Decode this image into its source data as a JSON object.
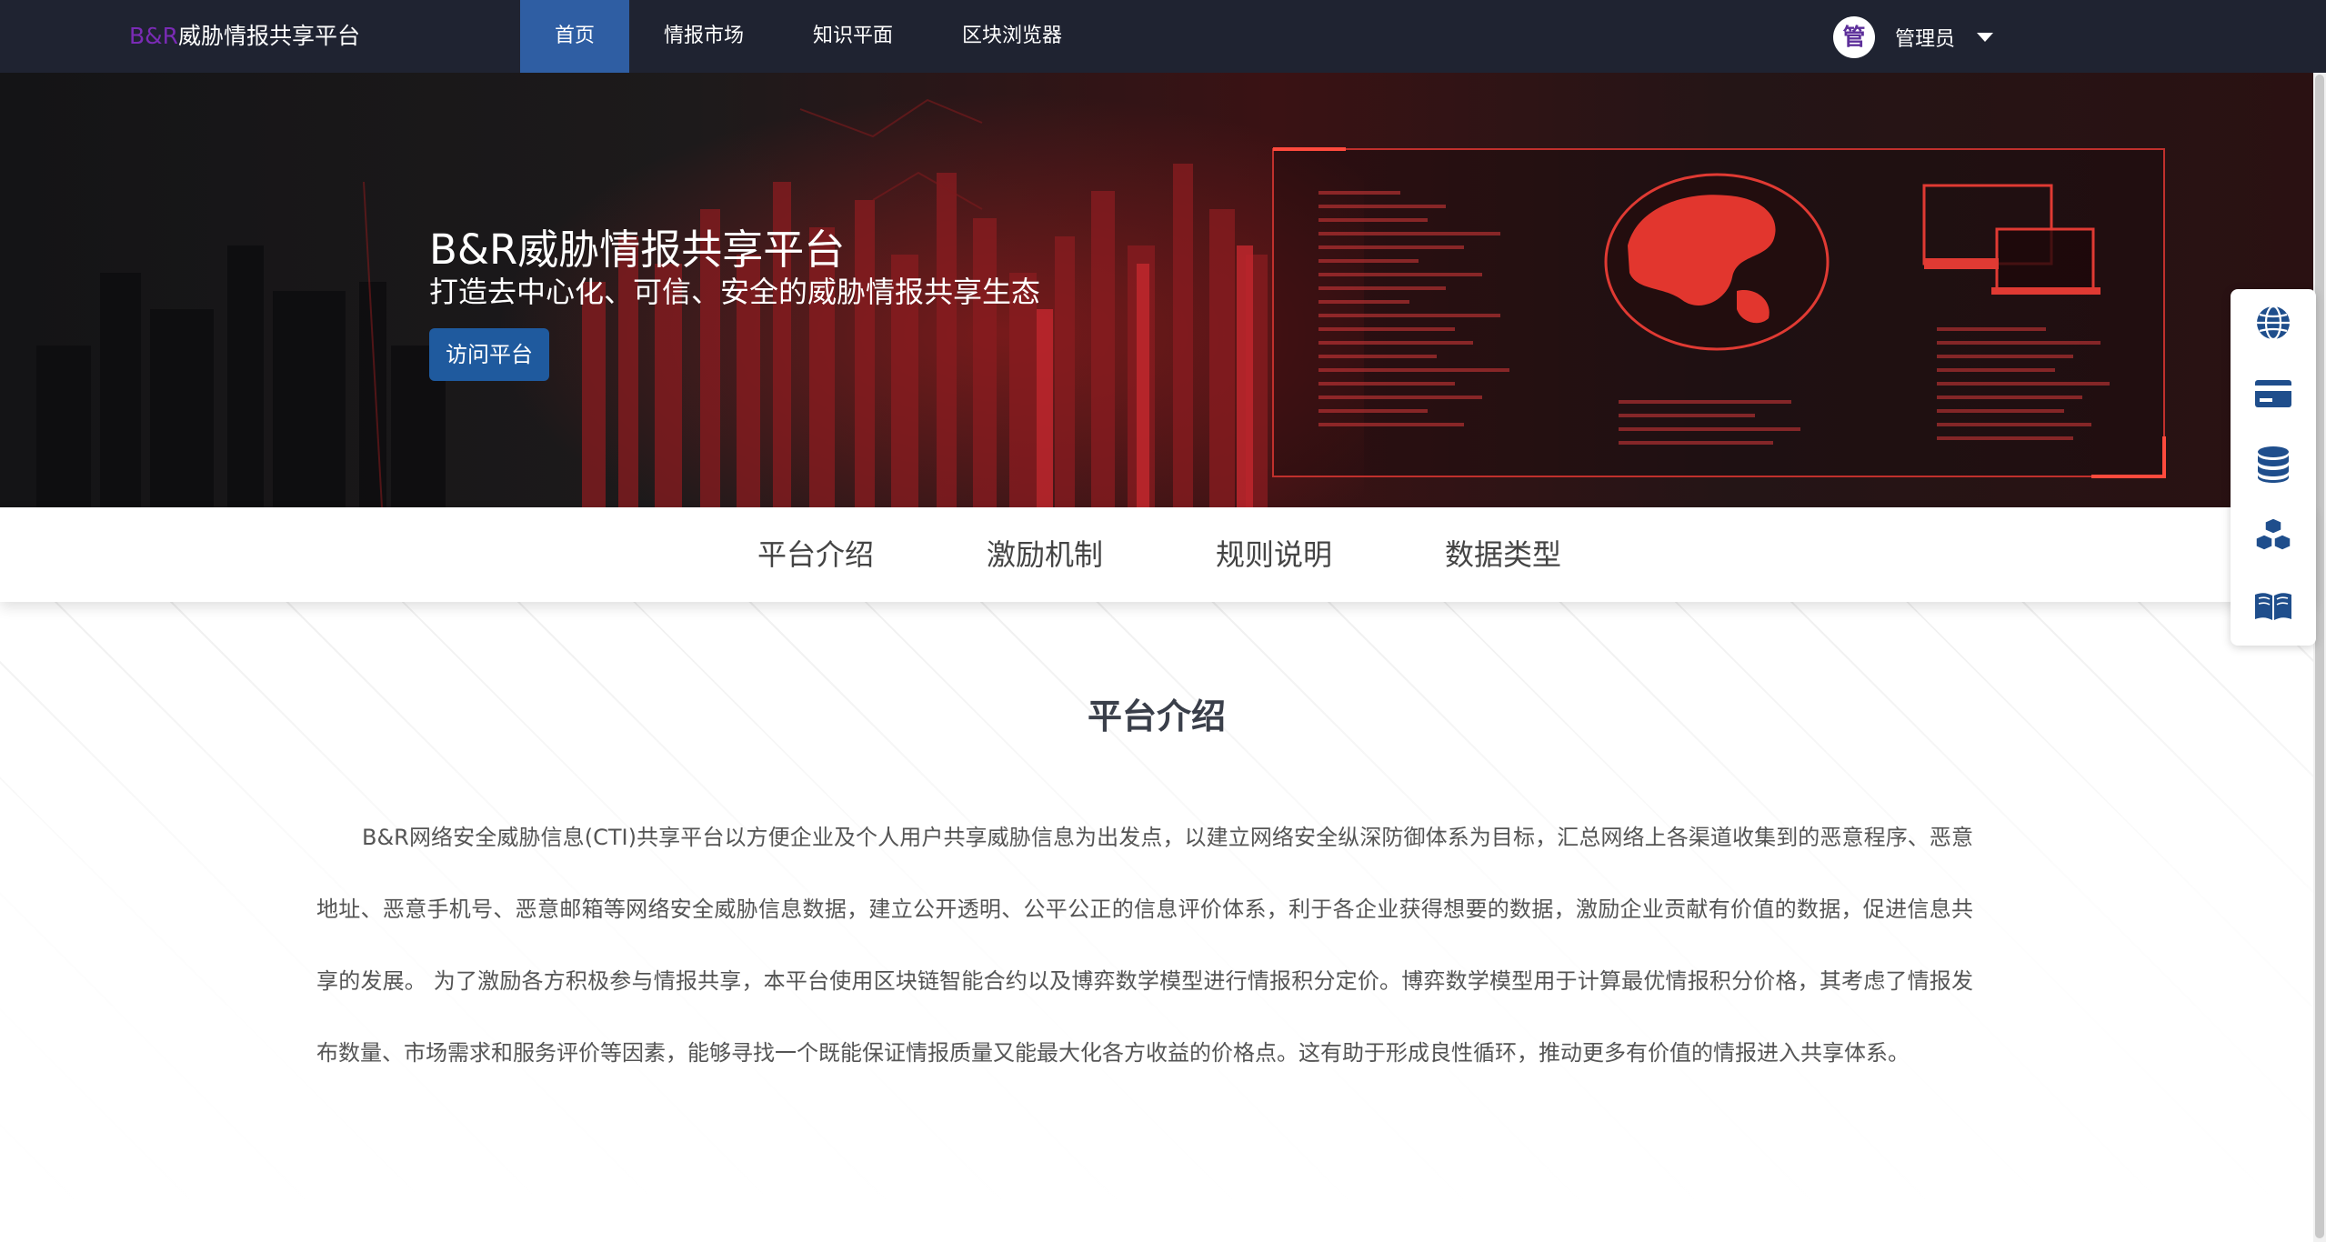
{
  "brand": {
    "prefix": "B&R",
    "suffix": "威胁情报共享平台"
  },
  "nav": {
    "items": [
      {
        "label": "首页",
        "active": true
      },
      {
        "label": "情报市场",
        "active": false
      },
      {
        "label": "知识平面",
        "active": false
      },
      {
        "label": "区块浏览器",
        "active": false
      }
    ]
  },
  "user": {
    "avatar_char": "管",
    "name": "管理员"
  },
  "hero": {
    "title": "B&R威胁情报共享平台",
    "subtitle": "打造去中心化、可信、安全的威胁情报共享生态",
    "button": "访问平台"
  },
  "tabs": [
    {
      "label": "平台介绍"
    },
    {
      "label": "激励机制"
    },
    {
      "label": "规则说明"
    },
    {
      "label": "数据类型"
    }
  ],
  "section": {
    "title": "平台介绍",
    "body": "B&R网络安全威胁信息(CTI)共享平台以方便企业及个人用户共享威胁信息为出发点，以建立网络安全纵深防御体系为目标，汇总网络上各渠道收集到的恶意程序、恶意地址、恶意手机号、恶意邮箱等网络安全威胁信息数据，建立公开透明、公平公正的信息评价体系，利于各企业获得想要的数据，激励企业贡献有价值的数据，促进信息共享的发展。 为了激励各方积极参与情报共享，本平台使用区块链智能合约以及博弈数学模型进行情报积分定价。博弈数学模型用于计算最优情报积分价格，其考虑了情报发布数量、市场需求和服务评价等因素，能够寻找一个既能保证情报质量又能最大化各方收益的价格点。这有助于形成良性循环，推动更多有价值的情报进入共享体系。"
  },
  "side_toolbar": [
    {
      "icon": "globe-icon"
    },
    {
      "icon": "credit-card-icon"
    },
    {
      "icon": "database-icon"
    },
    {
      "icon": "cubes-icon"
    },
    {
      "icon": "book-icon"
    }
  ],
  "colors": {
    "nav_bg": "#1f2331",
    "nav_active": "#2f5ea3",
    "brand_prefix": "#7a2bb5",
    "hero_button": "#1f5a9e",
    "icon_blue": "#1f4e8c"
  }
}
